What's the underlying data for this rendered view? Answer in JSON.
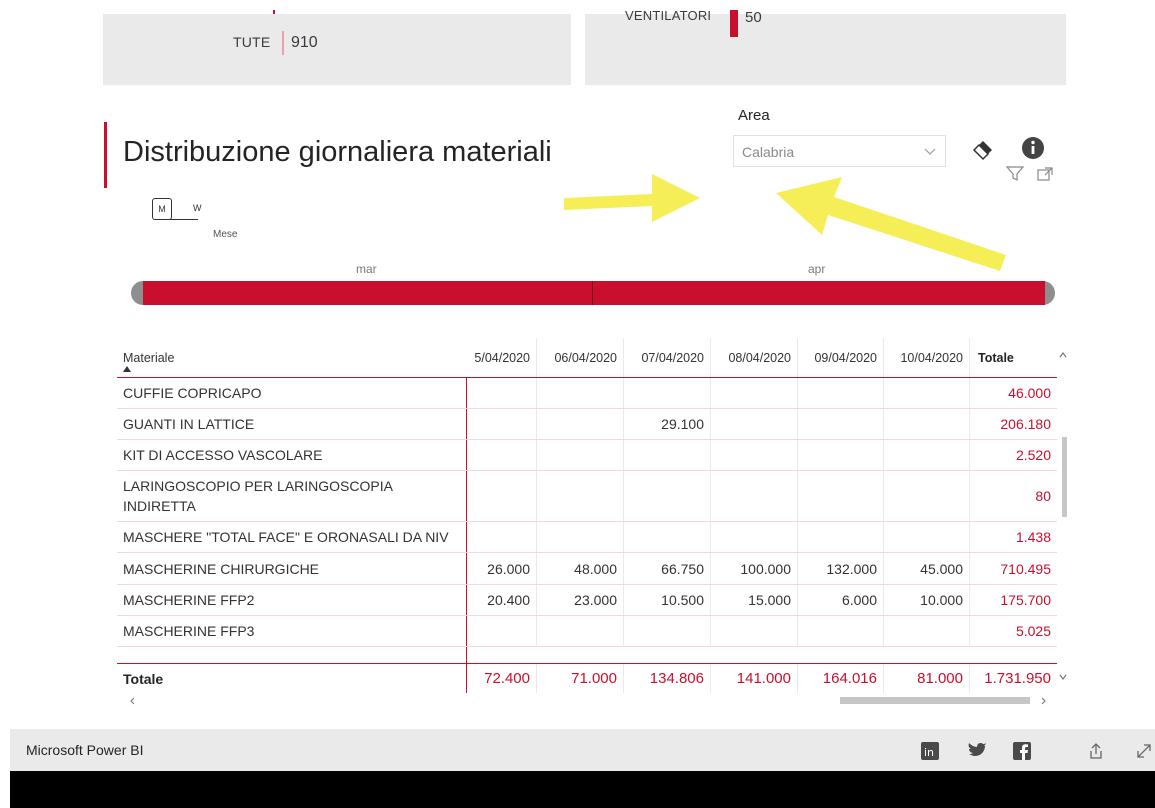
{
  "top_cards": {
    "left": {
      "label": "TUTE",
      "value": "910"
    },
    "right": {
      "label": "VENTILATORI",
      "value": "50"
    }
  },
  "title": "Distribuzione giornaliera materiali",
  "slicer": {
    "label": "Area",
    "value": "Calabria"
  },
  "timeline": {
    "toggle_m": "M",
    "toggle_w": "W",
    "granularity_label": "Mese",
    "months": [
      "mar",
      "apr"
    ]
  },
  "table": {
    "column_header_material": "Materiale",
    "date_columns": [
      "5/04/2020",
      "06/04/2020",
      "07/04/2020",
      "08/04/2020",
      "09/04/2020",
      "10/04/2020"
    ],
    "total_header": "Totale",
    "rows": [
      {
        "name": "CUFFIE COPRICAPO",
        "values": [
          "",
          "",
          "",
          "",
          "",
          ""
        ],
        "total": "46.000"
      },
      {
        "name": "GUANTI IN LATTICE",
        "values": [
          "",
          "",
          "29.100",
          "",
          "",
          ""
        ],
        "total": "206.180"
      },
      {
        "name": "KIT DI ACCESSO VASCOLARE",
        "values": [
          "",
          "",
          "",
          "",
          "",
          ""
        ],
        "total": "2.520"
      },
      {
        "name": "LARINGOSCOPIO PER LARINGOSCOPIA INDIRETTA",
        "values": [
          "",
          "",
          "",
          "",
          "",
          ""
        ],
        "total": "80"
      },
      {
        "name": "MASCHERE \"TOTAL FACE\" E ORONASALI DA NIV",
        "values": [
          "",
          "",
          "",
          "",
          "",
          ""
        ],
        "total": "1.438"
      },
      {
        "name": "MASCHERINE CHIRURGICHE",
        "values": [
          "26.000",
          "48.000",
          "66.750",
          "100.000",
          "132.000",
          "45.000"
        ],
        "total": "710.495"
      },
      {
        "name": "MASCHERINE FFP2",
        "values": [
          "20.400",
          "23.000",
          "10.500",
          "15.000",
          "6.000",
          "10.000"
        ],
        "total": "175.700"
      },
      {
        "name": "MASCHERINE FFP3",
        "values": [
          "",
          "",
          "",
          "",
          "",
          ""
        ],
        "total": "5.025"
      }
    ],
    "total_row": {
      "label": "Totale",
      "values": [
        "72.400",
        "71.000",
        "134.806",
        "141.000",
        "164.016",
        "81.000"
      ],
      "total": "1.731.950"
    }
  },
  "footer": {
    "brand": "Microsoft Power BI"
  },
  "colors": {
    "accent": "#c8102e",
    "annotation_arrow": "#f5ee57",
    "footer_bg": "#eaeaea"
  },
  "icons": [
    "eraser-icon",
    "info-icon",
    "filter-icon",
    "focus-mode-icon",
    "chevron-down-icon",
    "sort-asc-icon",
    "linkedin-icon",
    "twitter-icon",
    "facebook-icon",
    "share-icon",
    "fullscreen-icon"
  ]
}
